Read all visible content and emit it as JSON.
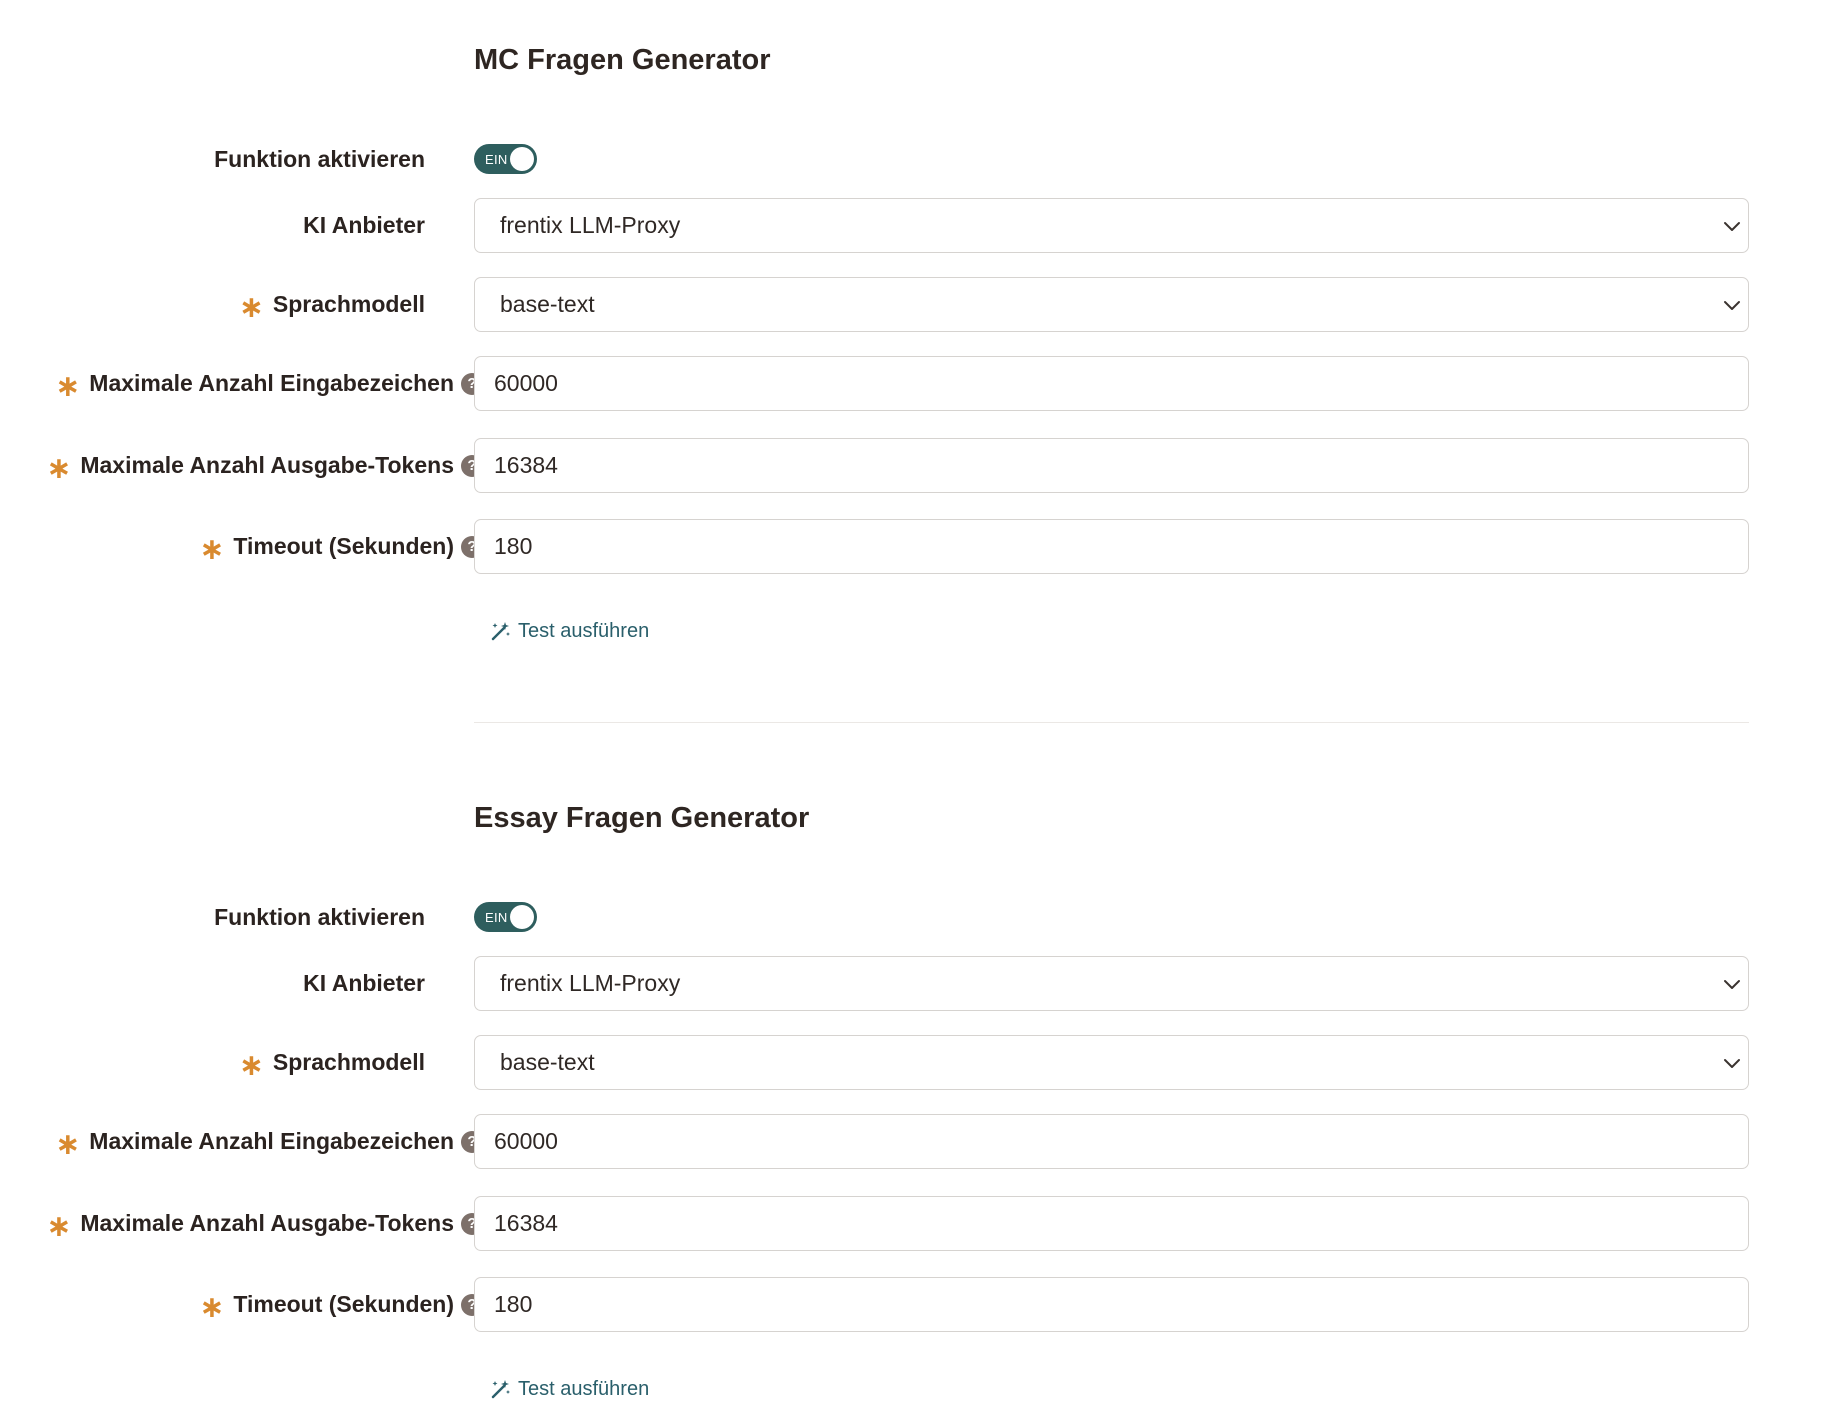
{
  "sections": [
    {
      "title": "MC Fragen Generator",
      "enable_label": "Funktion aktivieren",
      "toggle_text": "EIN",
      "provider_label": "KI Anbieter",
      "provider_value": "frentix LLM-Proxy",
      "model_label": "Sprachmodell",
      "model_value": "base-text",
      "max_input_label": "Maximale Anzahl Eingabezeichen",
      "max_input_value": "60000",
      "max_output_label": "Maximale Anzahl Ausgabe-Tokens",
      "max_output_value": "16384",
      "timeout_label": "Timeout (Sekunden)",
      "timeout_value": "180",
      "test_label": "Test ausführen"
    },
    {
      "title": "Essay Fragen Generator",
      "enable_label": "Funktion aktivieren",
      "toggle_text": "EIN",
      "provider_label": "KI Anbieter",
      "provider_value": "frentix LLM-Proxy",
      "model_label": "Sprachmodell",
      "model_value": "base-text",
      "max_input_label": "Maximale Anzahl Eingabezeichen",
      "max_input_value": "60000",
      "max_output_label": "Maximale Anzahl Ausgabe-Tokens",
      "max_output_value": "16384",
      "timeout_label": "Timeout (Sekunden)",
      "timeout_value": "180",
      "test_label": "Test ausführen"
    }
  ],
  "required_marker": "∗",
  "help_marker": "?",
  "icons": {
    "dropdown": "chevron-down-icon",
    "help": "question-circle-icon",
    "test": "magic-wand-icon"
  },
  "colors": {
    "required": "#d98a2f",
    "toggle_on": "#2e5e5e",
    "link": "#2a5f6b",
    "help_bg": "#7d706a"
  }
}
